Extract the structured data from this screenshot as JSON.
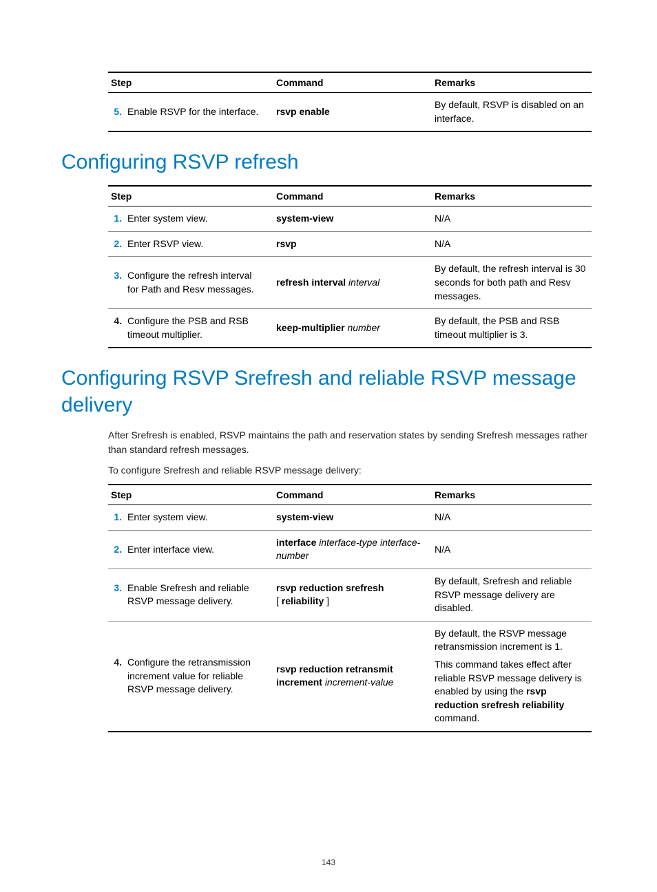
{
  "page_number": "143",
  "headers": {
    "step": "Step",
    "command": "Command",
    "remarks": "Remarks"
  },
  "table_top": {
    "rows": [
      {
        "num": "5.",
        "num_accent": true,
        "desc": "Enable RSVP for the interface.",
        "cmd_bold": "rsvp enable",
        "cmd_italic": "",
        "remarks": "By default, RSVP is disabled on an interface."
      }
    ]
  },
  "section1": {
    "title": "Configuring RSVP refresh",
    "rows": [
      {
        "num": "1.",
        "num_accent": true,
        "desc": "Enter system view.",
        "cmd_bold": "system-view",
        "cmd_italic": "",
        "remarks": "N/A"
      },
      {
        "num": "2.",
        "num_accent": true,
        "desc": "Enter RSVP view.",
        "cmd_bold": "rsvp",
        "cmd_italic": "",
        "remarks": "N/A"
      },
      {
        "num": "3.",
        "num_accent": true,
        "desc": "Configure the refresh interval for Path and Resv messages.",
        "cmd_bold": "refresh interval",
        "cmd_italic": " interval",
        "remarks": "By default, the refresh interval is 30 seconds for both path and Resv messages."
      },
      {
        "num": "4.",
        "num_accent": false,
        "desc": "Configure the PSB and RSB timeout multiplier.",
        "cmd_bold": "keep-multiplier",
        "cmd_italic": " number",
        "remarks": "By default, the PSB and RSB timeout multiplier is 3."
      }
    ]
  },
  "section2": {
    "title": "Configuring RSVP Srefresh and reliable RSVP message delivery",
    "intro1": "After Srefresh is enabled, RSVP maintains the path and reservation states by sending Srefresh messages rather than standard refresh messages.",
    "intro2": "To configure Srefresh and reliable RSVP message delivery:",
    "rows": [
      {
        "num": "1.",
        "num_accent": true,
        "desc": "Enter system view.",
        "cmd_html": "<span class=\"cmd-bold\">system-view</span>",
        "remarks_html": "N/A"
      },
      {
        "num": "2.",
        "num_accent": true,
        "desc": "Enter interface view.",
        "cmd_html": "<span class=\"cmd-bold\">interface</span> <span class=\"cmd-italic\">interface-type interface-number</span>",
        "remarks_html": "N/A"
      },
      {
        "num": "3.",
        "num_accent": true,
        "desc": "Enable Srefresh and reliable RSVP message delivery.",
        "cmd_html": "<span class=\"cmd-bold\">rsvp reduction srefresh</span><br>[ <span class=\"cmd-bold\">reliability</span> ]",
        "remarks_html": "By default, Srefresh and reliable RSVP message delivery are disabled."
      },
      {
        "num": "4.",
        "num_accent": false,
        "desc": "Configure the retransmission increment value for reliable RSVP message delivery.",
        "cmd_html": "<span class=\"cmd-bold\">rsvp reduction retransmit increment</span> <span class=\"cmd-italic\">increment-value</span>",
        "remarks_html": "<p>By default, the RSVP message retransmission increment is 1.</p><p>This command takes effect after reliable RSVP message delivery is enabled by using the <span class=\"cmd-bold\">rsvp reduction srefresh reliability</span> command.</p>"
      }
    ]
  }
}
